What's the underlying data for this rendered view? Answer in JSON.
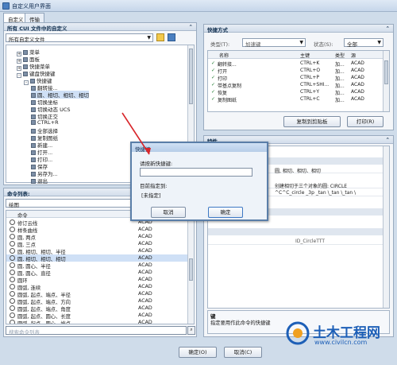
{
  "window": {
    "title": "自定义用户界面"
  },
  "tabs": [
    {
      "label": "自定义"
    },
    {
      "label": "传输"
    }
  ],
  "left_panel": {
    "header": "所有 CUI 文件中的自定义",
    "combo_value": "所有自定义文件",
    "tree": [
      {
        "label": "菜单",
        "depth": 1,
        "expander": "+"
      },
      {
        "label": "面板",
        "depth": 1,
        "expander": "+"
      },
      {
        "label": "快捷菜单",
        "depth": 1,
        "expander": "+"
      },
      {
        "label": "键盘快捷键",
        "depth": 1,
        "expander": "-"
      },
      {
        "label": "快捷键",
        "depth": 2,
        "expander": "-"
      },
      {
        "label": "翻转接...",
        "depth": 3
      },
      {
        "label": "圆、相切、相切、相切",
        "depth": 3
      },
      {
        "label": "切换坐标",
        "depth": 3
      },
      {
        "label": "切换动态 UCS",
        "depth": 3
      },
      {
        "label": "切换正交",
        "depth": 3
      },
      {
        "label": "CTRL+R",
        "depth": 3
      },
      {
        "label": "全部选择",
        "depth": 3
      },
      {
        "label": "复制图纸",
        "depth": 3
      },
      {
        "label": "新建...",
        "depth": 3
      },
      {
        "label": "打开...",
        "depth": 3
      },
      {
        "label": "打印...",
        "depth": 3
      },
      {
        "label": "保存",
        "depth": 3
      },
      {
        "label": "另存为...",
        "depth": 3
      },
      {
        "label": "退出",
        "depth": 3
      }
    ]
  },
  "command_list": {
    "header": "命令列表:",
    "filter_value": "绘图",
    "col_command": "命令",
    "col_source": "源",
    "rows": [
      {
        "name": "修订云线",
        "source": "ACAD"
      },
      {
        "name": "样条曲线",
        "source": "ACAD"
      },
      {
        "name": "圆, 两点",
        "source": "ACAD"
      },
      {
        "name": "圆, 三点",
        "source": "ACAD"
      },
      {
        "name": "圆, 相切、相切、半径",
        "source": "ACAD"
      },
      {
        "name": "圆, 相切、相切、相切",
        "source": "ACAD"
      },
      {
        "name": "圆, 圆心、半径",
        "source": "ACAD"
      },
      {
        "name": "圆, 圆心、直径",
        "source": "ACAD"
      },
      {
        "name": "圆环",
        "source": "ACAD"
      },
      {
        "name": "圆弧, 连续",
        "source": "ACAD"
      },
      {
        "name": "圆弧, 起点、端点、半径",
        "source": "ACAD"
      },
      {
        "name": "圆弧, 起点、端点、方向",
        "source": "ACAD"
      },
      {
        "name": "圆弧, 起点、端点、角度",
        "source": "ACAD"
      },
      {
        "name": "圆弧, 起点、圆心、长度",
        "source": "ACAD"
      },
      {
        "name": "圆弧, 起点、圆心、端点",
        "source": "ACAD"
      }
    ],
    "search_placeholder": "搜索命令列表"
  },
  "shortcut_panel": {
    "header": "快捷方式",
    "type_label": "类型(T):",
    "type_value": "加速键",
    "status_label": "状态(S):",
    "status_value": "全部",
    "columns": [
      "名称",
      "主键",
      "类型",
      "源"
    ],
    "rows": [
      {
        "name": "翻转接...",
        "key": "CTRL+K",
        "type": "加...",
        "source": "ACAD"
      },
      {
        "name": "打开",
        "key": "CTRL+O",
        "type": "加...",
        "source": "ACAD"
      },
      {
        "name": "打印",
        "key": "CTRL+P",
        "type": "加...",
        "source": "ACAD"
      },
      {
        "name": "带基点复制",
        "key": "CTRL+SHI...",
        "type": "加...",
        "source": "ACAD"
      },
      {
        "name": "恢复",
        "key": "CTRL+Y",
        "type": "加...",
        "source": "ACAD"
      },
      {
        "name": "复制图纸",
        "key": "CTRL+C",
        "type": "加...",
        "source": "ACAD"
      }
    ],
    "copy_button": "复制到剪贴板",
    "print_button": "打印(R)"
  },
  "properties_panel": {
    "header": "特性",
    "name_value": "圆, 相切、相切、相切",
    "description_value": "创建相切于三个对象的圆: CIRCLE",
    "macro_value": "^C^C_circle _3p _tan \\_tan \\_tan \\",
    "element_id": "ID_CircleTTT",
    "help_header": "键",
    "help_text": "指定要用作此命令的快捷键"
  },
  "dialog": {
    "title": "快捷键",
    "prompt": "请按新快捷键:",
    "input_value": "",
    "assigned_label": "目前指定到:",
    "assigned_value": "[未指定]",
    "cancel_button": "取消",
    "ok_button": "确定"
  },
  "bottom_buttons": {
    "ok": "确定(O)",
    "cancel": "取消(C)"
  },
  "watermark": {
    "brand": "土木工程网",
    "url": "www.civilcn.com"
  }
}
